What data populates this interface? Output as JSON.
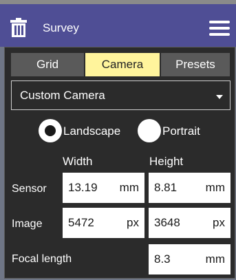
{
  "header": {
    "title": "Survey",
    "icons": {
      "left": "trash-icon",
      "right": "hamburger-menu-icon"
    }
  },
  "tabs": [
    {
      "label": "Grid",
      "active": false
    },
    {
      "label": "Camera",
      "active": true
    },
    {
      "label": "Presets",
      "active": false
    }
  ],
  "camera_select": {
    "value": "Custom Camera"
  },
  "orientation": {
    "landscape_label": "Landscape",
    "portrait_label": "Portrait",
    "selected": "Landscape"
  },
  "columns": {
    "width": "Width",
    "height": "Height"
  },
  "sensor": {
    "label": "Sensor",
    "width": {
      "value": "13.19",
      "unit": "mm"
    },
    "height": {
      "value": "8.81",
      "unit": "mm"
    }
  },
  "image": {
    "label": "Image",
    "width": {
      "value": "5472",
      "unit": "px"
    },
    "height": {
      "value": "3648",
      "unit": "px"
    }
  },
  "focal": {
    "label": "Focal length",
    "value": "8.3",
    "unit": "mm"
  },
  "colors": {
    "header_bg": "#4f4e95",
    "panel_bg": "#2b2b2b",
    "active_tab": "#fff49c",
    "inactive_tab": "#5a5a5a"
  }
}
